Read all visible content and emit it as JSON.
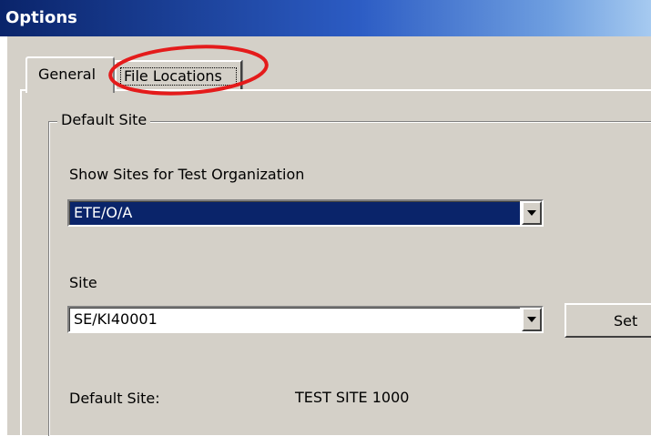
{
  "window": {
    "title": "Options"
  },
  "tabs": [
    {
      "label": "General",
      "active": true
    },
    {
      "label": "File Locations",
      "active": false
    }
  ],
  "group": {
    "legend": "Default Site",
    "org_label": "Show Sites for Test Organization",
    "org_value": "ETE/O/A",
    "site_label": "Site",
    "site_value": "SE/KI40001",
    "set_label": "Set",
    "default_site_label": "Default Site:",
    "default_site_value": "TEST SITE 1000"
  },
  "annotation": {
    "color": "#e41b1b",
    "shape": "ellipse"
  },
  "colors": {
    "titlebar": "#0a246a",
    "dialog": "#d4d0c8",
    "selection": "#0a246a"
  }
}
